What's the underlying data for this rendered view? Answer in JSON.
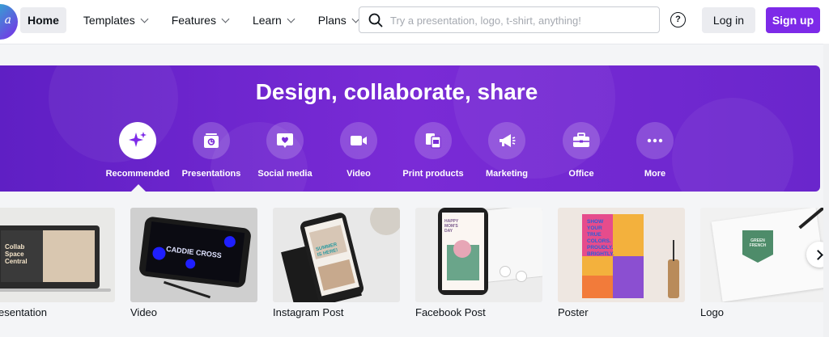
{
  "header": {
    "logo_text": "a",
    "nav": [
      {
        "label": "Home",
        "active": true,
        "dropdown": false
      },
      {
        "label": "Templates",
        "active": false,
        "dropdown": true
      },
      {
        "label": "Features",
        "active": false,
        "dropdown": true
      },
      {
        "label": "Learn",
        "active": false,
        "dropdown": true
      },
      {
        "label": "Plans",
        "active": false,
        "dropdown": true
      }
    ],
    "search": {
      "placeholder": "Try a presentation, logo, t-shirt, anything!",
      "value": ""
    },
    "help_icon": "?",
    "login_label": "Log in",
    "signup_label": "Sign up"
  },
  "hero": {
    "title": "Design, collaborate, share",
    "categories": [
      {
        "label": "Recommended",
        "icon": "sparkle-icon",
        "selected": true
      },
      {
        "label": "Presentations",
        "icon": "presentation-icon",
        "selected": false
      },
      {
        "label": "Social media",
        "icon": "heart-bubble-icon",
        "selected": false
      },
      {
        "label": "Video",
        "icon": "video-camera-icon",
        "selected": false
      },
      {
        "label": "Print products",
        "icon": "print-products-icon",
        "selected": false
      },
      {
        "label": "Marketing",
        "icon": "megaphone-icon",
        "selected": false
      },
      {
        "label": "Office",
        "icon": "briefcase-icon",
        "selected": false
      },
      {
        "label": "More",
        "icon": "more-dots-icon",
        "selected": false
      }
    ]
  },
  "templates": [
    {
      "label": "Presentation",
      "thumb_text": [
        "Collab",
        "Space",
        "Central"
      ]
    },
    {
      "label": "Video",
      "thumb_text": [
        "CADDIE CROSS"
      ]
    },
    {
      "label": "Instagram Post",
      "thumb_text": [
        "SUMMER",
        "IS HERE!"
      ]
    },
    {
      "label": "Facebook Post",
      "thumb_text": [
        "HAPPY",
        "MOM'S",
        "DAY"
      ]
    },
    {
      "label": "Poster",
      "thumb_text": [
        "SHOW",
        "YOUR",
        "TRUE",
        "COLORS.",
        "PROUDLY.",
        "BRIGHTLY."
      ]
    },
    {
      "label": "Logo",
      "thumb_text": [
        "GREEN",
        "FRENCH"
      ]
    }
  ],
  "colors": {
    "brand_purple": "#7d2ae8",
    "hero_purple": "#6a26cc"
  }
}
